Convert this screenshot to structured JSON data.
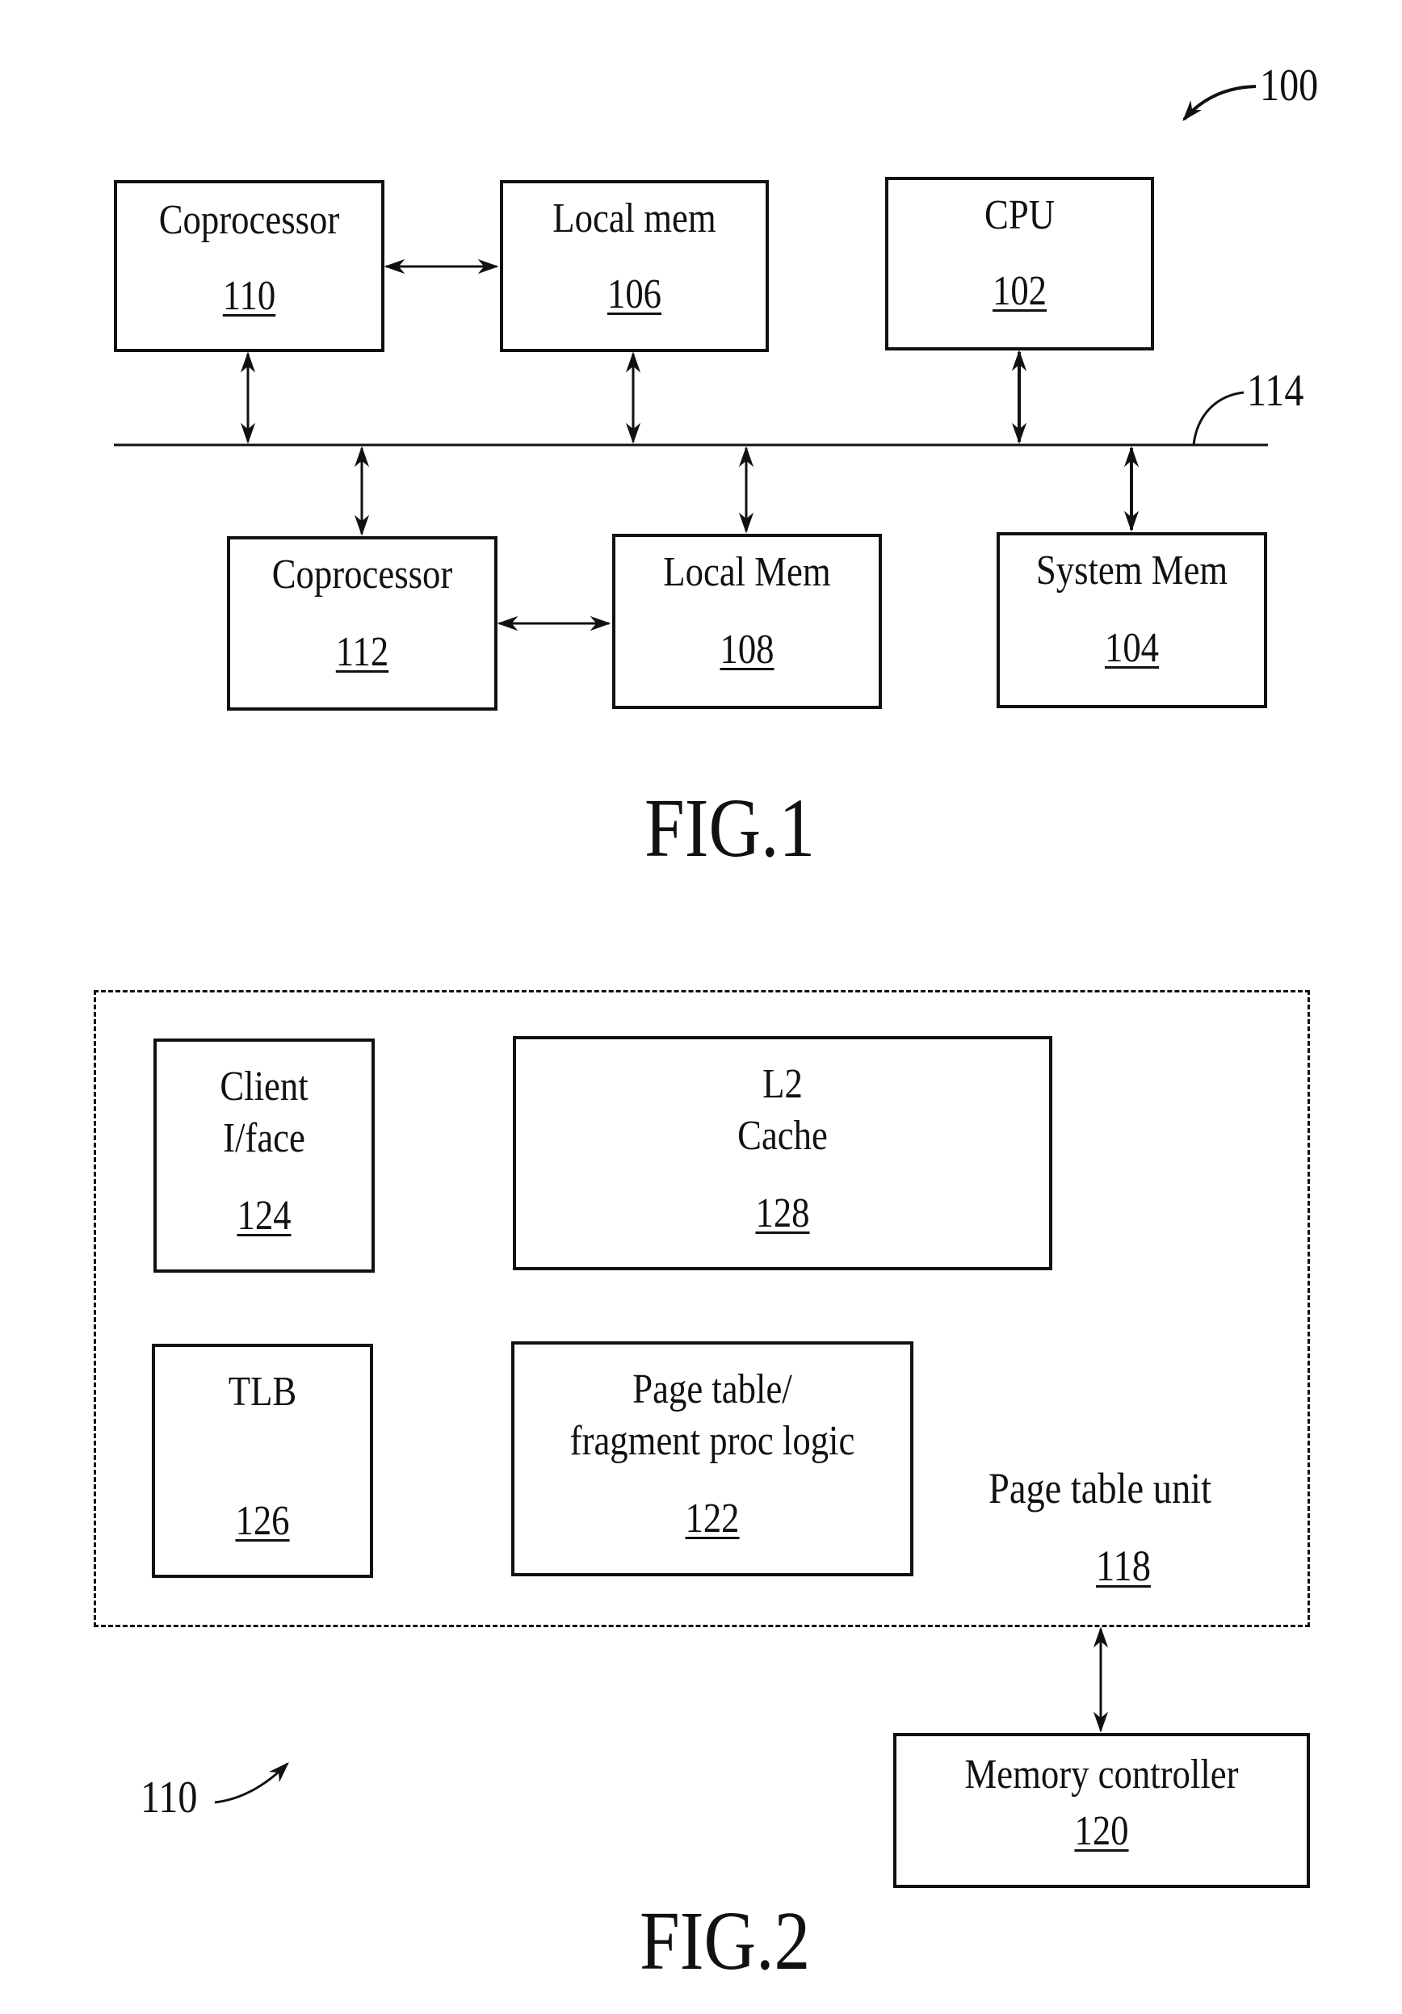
{
  "figure1": {
    "title": "FIG.1",
    "system_ref": "100",
    "bus_ref": "114",
    "blocks": {
      "coprocessor_110": {
        "label": "Coprocessor",
        "ref": "110"
      },
      "local_mem_106": {
        "label": "Local mem",
        "ref": "106"
      },
      "cpu_102": {
        "label": "CPU",
        "ref": "102"
      },
      "coprocessor_112": {
        "label": "Coprocessor",
        "ref": "112"
      },
      "local_mem_108": {
        "label": "Local Mem",
        "ref": "108"
      },
      "system_mem_104": {
        "label": "System Mem",
        "ref": "104"
      }
    }
  },
  "figure2": {
    "title": "FIG.2",
    "coprocessor_ref": "110",
    "page_table_unit": {
      "label": "Page table unit",
      "ref": "118"
    },
    "blocks": {
      "client_iface_124": {
        "label": "Client\nI/face",
        "ref": "124"
      },
      "l2_cache_128": {
        "label": "L2\nCache",
        "ref": "128"
      },
      "tlb_126": {
        "label": "TLB",
        "ref": "126"
      },
      "page_table_logic_122": {
        "label": "Page table/\nfragment proc logic",
        "ref": "122"
      },
      "memory_controller_120": {
        "label": "Memory controller",
        "ref": "120"
      }
    }
  }
}
